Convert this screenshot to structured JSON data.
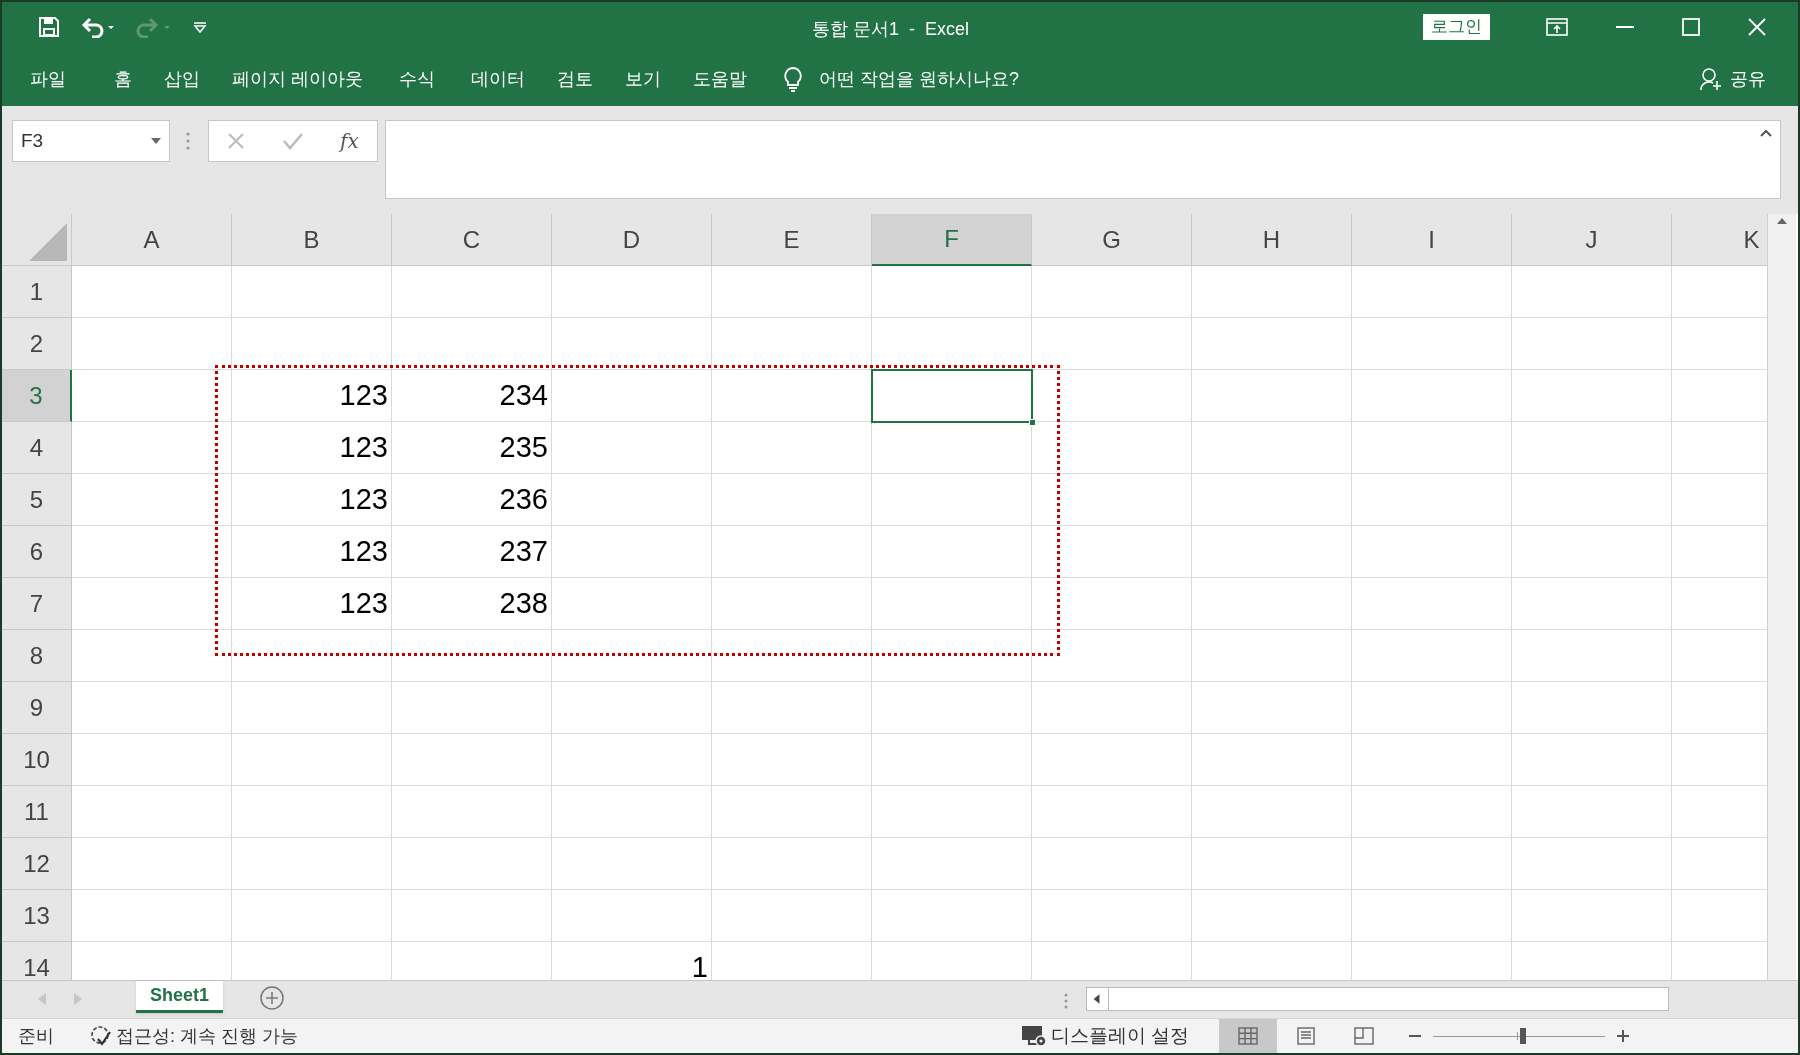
{
  "title_bar": {
    "title": "통합 문서1  -  Excel",
    "login": "로그인"
  },
  "ribbon_tabs": [
    "파일",
    "홈",
    "삽입",
    "페이지 레이아웃",
    "수식",
    "데이터",
    "검토",
    "보기",
    "도움말"
  ],
  "tell_me": "어떤 작업을 원하시나요?",
  "share": "공유",
  "formula_bar": {
    "name_box": "F3",
    "function_label": "fx"
  },
  "columns": [
    {
      "label": "A",
      "selected": false
    },
    {
      "label": "B",
      "selected": false
    },
    {
      "label": "C",
      "selected": false
    },
    {
      "label": "D",
      "selected": false
    },
    {
      "label": "E",
      "selected": false
    },
    {
      "label": "F",
      "selected": true
    },
    {
      "label": "G",
      "selected": false
    },
    {
      "label": "H",
      "selected": false
    },
    {
      "label": "I",
      "selected": false
    },
    {
      "label": "J",
      "selected": false
    },
    {
      "label": "K",
      "selected": false
    }
  ],
  "rows": [
    {
      "label": "1",
      "selected": false,
      "cells": {}
    },
    {
      "label": "2",
      "selected": false,
      "cells": {}
    },
    {
      "label": "3",
      "selected": true,
      "cells": {
        "B": "123",
        "C": "234"
      }
    },
    {
      "label": "4",
      "selected": false,
      "cells": {
        "B": "123",
        "C": "235"
      }
    },
    {
      "label": "5",
      "selected": false,
      "cells": {
        "B": "123",
        "C": "236"
      }
    },
    {
      "label": "6",
      "selected": false,
      "cells": {
        "B": "123",
        "C": "237"
      }
    },
    {
      "label": "7",
      "selected": false,
      "cells": {
        "B": "123",
        "C": "238"
      }
    },
    {
      "label": "8",
      "selected": false,
      "cells": {}
    },
    {
      "label": "9",
      "selected": false,
      "cells": {}
    },
    {
      "label": "10",
      "selected": false,
      "cells": {}
    },
    {
      "label": "11",
      "selected": false,
      "cells": {}
    },
    {
      "label": "12",
      "selected": false,
      "cells": {}
    },
    {
      "label": "13",
      "selected": false,
      "cells": {}
    },
    {
      "label": "14",
      "selected": false,
      "cells": {
        "D": "1"
      }
    }
  ],
  "sheet_tabs": [
    {
      "label": "Sheet1",
      "selected": true
    }
  ],
  "status_bar": {
    "ready": "준비",
    "accessibility": "접근성: 계속 진행 가능",
    "display_settings": "디스플레이 설정",
    "views": [
      {
        "kind": "normal",
        "selected": true
      },
      {
        "kind": "page-layout",
        "selected": false
      },
      {
        "kind": "page-break",
        "selected": false
      }
    ],
    "zoom": {
      "level": 0.52
    }
  }
}
